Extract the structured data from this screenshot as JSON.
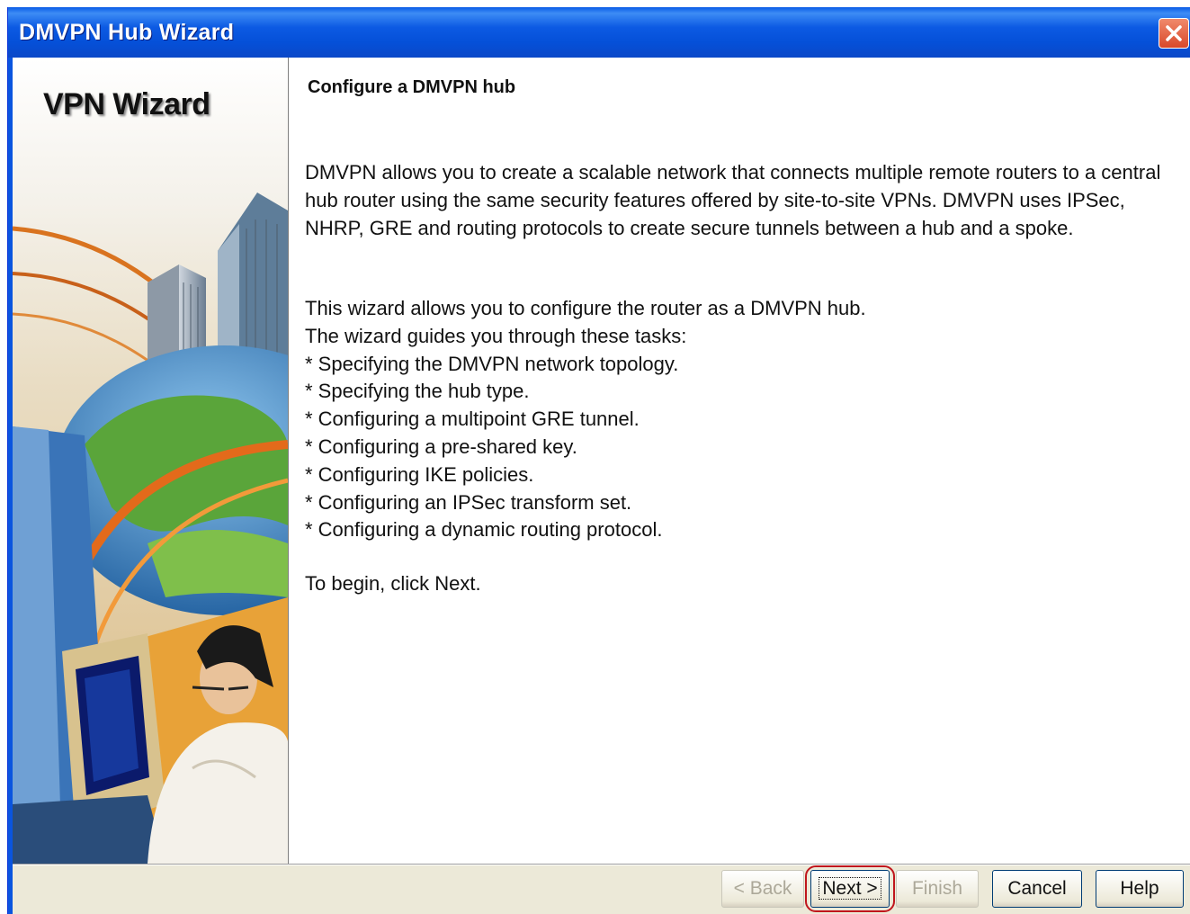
{
  "window": {
    "title": "DMVPN Hub Wizard",
    "close_icon": "close-x-icon"
  },
  "side_panel": {
    "title": "VPN Wizard",
    "illustration": "city-globe-user-illustration"
  },
  "content": {
    "heading": "Configure a DMVPN hub",
    "description": "DMVPN allows you to create a scalable network that connects multiple remote routers to a central hub router using the same security features offered by site-to-site VPNs. DMVPN uses IPSec, NHRP, GRE and routing protocols to create secure tunnels between a hub and a spoke.",
    "intro_lines": [
      "This wizard allows you to configure the router as a DMVPN hub.",
      "The wizard guides you through these tasks:"
    ],
    "tasks": [
      "* Specifying the DMVPN network topology.",
      "* Specifying the hub type.",
      "* Configuring a multipoint GRE tunnel.",
      "* Configuring a pre-shared key.",
      "* Configuring IKE policies.",
      "* Configuring an IPSec transform set.",
      "* Configuring a dynamic routing protocol."
    ],
    "begin_text": "To begin, click Next."
  },
  "buttons": {
    "back": "< Back",
    "next": "Next >",
    "finish": "Finish",
    "cancel": "Cancel",
    "help": "Help"
  },
  "colors": {
    "title_bar": "#0550d8",
    "highlight": "#c0161c"
  }
}
